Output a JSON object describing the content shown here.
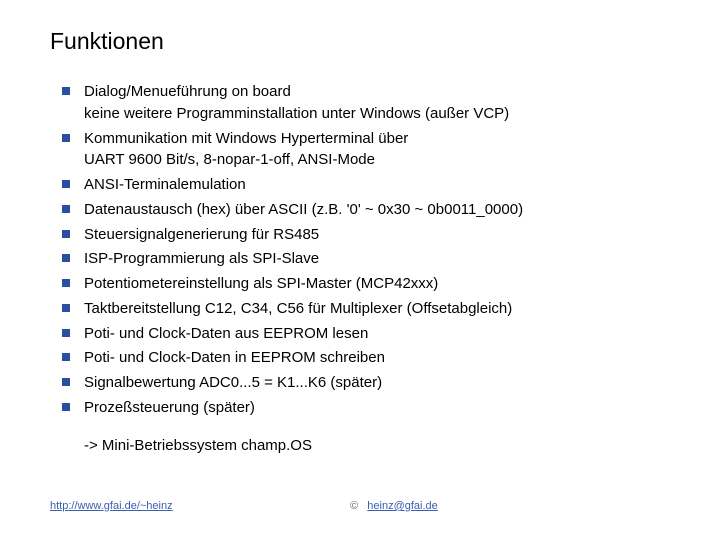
{
  "title": "Funktionen",
  "bullets": [
    "Dialog/Menueführung on board\nkeine weitere Programminstallation unter Windows (außer VCP)",
    "Kommunikation mit Windows Hyperterminal über\nUART 9600 Bit/s, 8-nopar-1-off, ANSI-Mode",
    "ANSI-Terminalemulation",
    "Datenaustausch (hex) über ASCII (z.B. '0' ~ 0x30 ~ 0b0011_0000)",
    "Steuersignalgenerierung für RS485",
    "ISP-Programmierung als SPI-Slave",
    "Potentiometereinstellung als SPI-Master (MCP42xxx)",
    "Taktbereitstellung C12, C34, C56 für Multiplexer (Offsetabgleich)",
    "Poti- und Clock-Daten aus EEPROM lesen",
    "Poti- und Clock-Daten in EEPROM schreiben",
    "Signalbewertung ADC0...5 = K1...K6 (später)",
    "Prozeßsteuerung (später)"
  ],
  "summary": "-> Mini-Betriebssystem champ.OS",
  "footer": {
    "link_text": "http://www.gfai.de/~heinz",
    "copyright": "©",
    "email": "heinz@gfai.de"
  }
}
